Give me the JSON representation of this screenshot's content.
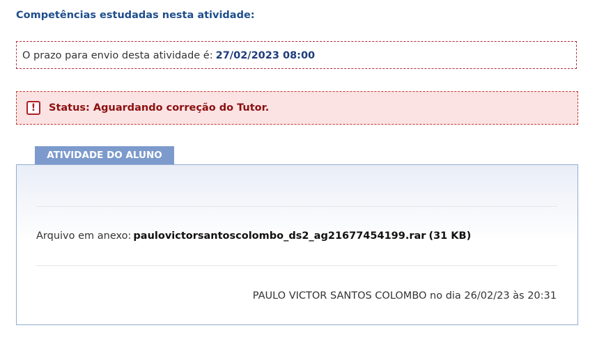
{
  "competencias": {
    "heading": "Competências estudadas nesta atividade:"
  },
  "deadline": {
    "label": "O prazo para envio desta atividade é:",
    "value": "27/02/2023 08:00"
  },
  "status": {
    "icon": "alert-icon",
    "icon_glyph": "!",
    "text": "Status: Aguardando correção do Tutor.",
    "color": "#8c1010",
    "background": "#fbe3e4"
  },
  "student_activity": {
    "tab_label": "ATIVIDADE DO ALUNO",
    "attachment_label": "Arquivo em anexo:",
    "attachment_file": "paulovictorsantoscolombo_ds2_ag21677454199.rar",
    "attachment_size": "(31 KB)",
    "author_line": "PAULO VICTOR SANTOS COLOMBO no dia 26/02/23 às 20:31"
  },
  "colors": {
    "heading": "#1f4e8c",
    "tab": "#7c9acc",
    "panel_border": "#93acd2"
  }
}
